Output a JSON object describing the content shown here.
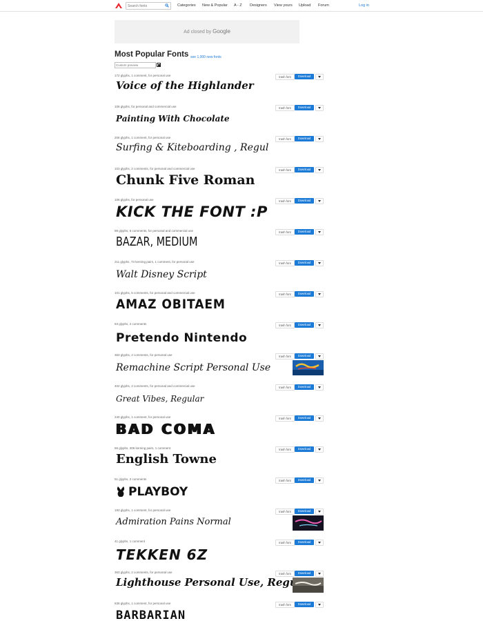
{
  "topbar": {
    "search_placeholder": "Search fonts",
    "nav": [
      "Categories",
      "New & Popular",
      "A - Z",
      "Designers",
      "View yours",
      "Upload",
      "Forum"
    ],
    "login": "Log in"
  },
  "ad": {
    "prefix": "Ad closed by",
    "brand": "Google"
  },
  "page": {
    "title": "Most Popular Fonts",
    "new_link": "see 1,000 new fonts",
    "preview_placeholder": "Custom preview"
  },
  "buttons": {
    "trash": "trash font",
    "download": "Download"
  },
  "fonts": [
    {
      "meta": "172 glyphs, 1 comment, for personal use",
      "name": "Voice of the Highlander",
      "thumb": false
    },
    {
      "meta": "106 glyphs, for personal and commercial use",
      "name": "Painting With Chocolate",
      "thumb": false
    },
    {
      "meta": "206 glyphs, 1 comment, for personal use",
      "name": "Surfing & Kiteboarding , Regul",
      "thumb": false
    },
    {
      "meta": "103 glyphs, 2 comments, for personal and commercial use",
      "name": "Chunk Five Roman",
      "thumb": false
    },
    {
      "meta": "106 glyphs, for personal use",
      "name": "KICK THE FONT :P",
      "thumb": false
    },
    {
      "meta": "98 glyphs, 6 comments, for personal and commercial use",
      "name": "BAZAR, MEDIUM",
      "thumb": false
    },
    {
      "meta": "211 glyphs, 73 kerning pairs, 1 comment, for personal use",
      "name": "Walt Disney Script",
      "thumb": false
    },
    {
      "meta": "101 glyphs, 5 comments, for personal and commercial use",
      "name": "AMAZ OBITAEM",
      "thumb": false
    },
    {
      "meta": "53 glyphs, 2 comments",
      "name": "Pretendo  Nintendo",
      "thumb": false
    },
    {
      "meta": "363 glyphs, 2 comments, for personal use",
      "name": "Remachine Script Personal Use",
      "thumb": true
    },
    {
      "meta": "402 glyphs, 2 comments, for personal and commercial use",
      "name": "Great Vibes, Regular",
      "thumb": false
    },
    {
      "meta": "240 glyphs, 1 comment, for personal use",
      "name": "BAD COMA",
      "thumb": false
    },
    {
      "meta": "56 glyphs, 206 kerning pairs, 1 comment",
      "name": "English  Towne",
      "thumb": false
    },
    {
      "meta": "51 glyphs, 2 comments",
      "name": "PLAYBOY",
      "thumb": false
    },
    {
      "meta": "193 glyphs, 1 comment, for personal use",
      "name": "Admiration Pains Normal",
      "thumb": true
    },
    {
      "meta": "41 glyphs, 1 comment",
      "name": "TEKKEN 6Z",
      "thumb": false
    },
    {
      "meta": "363 glyphs, 2 comments, for personal use",
      "name": "Lighthouse Personal Use, Regul",
      "thumb": true
    },
    {
      "meta": "636 glyphs, 1 comment, for personal use",
      "name": "BARBARIAN",
      "thumb": false
    }
  ]
}
